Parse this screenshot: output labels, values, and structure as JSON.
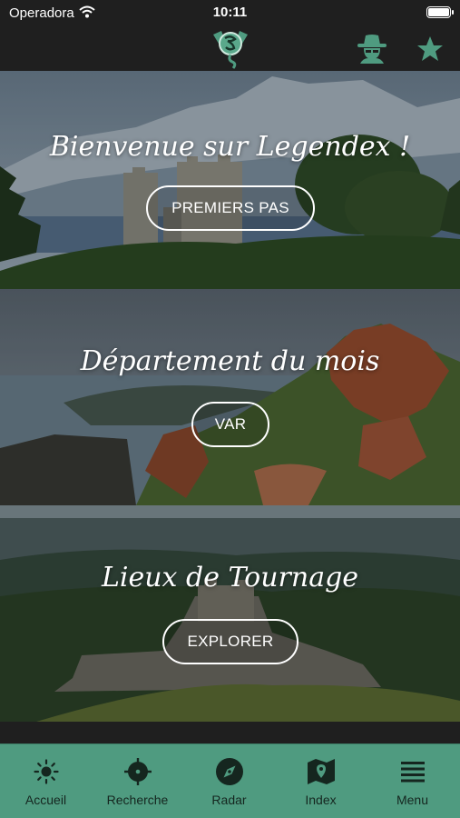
{
  "status_bar": {
    "carrier": "Operadora",
    "time": "10:11"
  },
  "nav": {
    "logo": "dragon-logo",
    "icons": [
      "detective-icon",
      "star-icon"
    ]
  },
  "cards": [
    {
      "title": "Bienvenue sur Legendex !",
      "button": "PREMIERS PAS"
    },
    {
      "title": "Département du mois",
      "button": "VAR"
    },
    {
      "title": "Lieux de Tournage",
      "button": "EXPLORER"
    }
  ],
  "tabs": [
    {
      "label": "Accueil",
      "icon": "sun-icon"
    },
    {
      "label": "Recherche",
      "icon": "crosshair-icon"
    },
    {
      "label": "Radar",
      "icon": "compass-icon"
    },
    {
      "label": "Index",
      "icon": "map-icon"
    },
    {
      "label": "Menu",
      "icon": "menu-icon"
    }
  ],
  "colors": {
    "accent": "#4f9b80",
    "bar": "#1f1f1f",
    "tab_label": "#15261f"
  }
}
